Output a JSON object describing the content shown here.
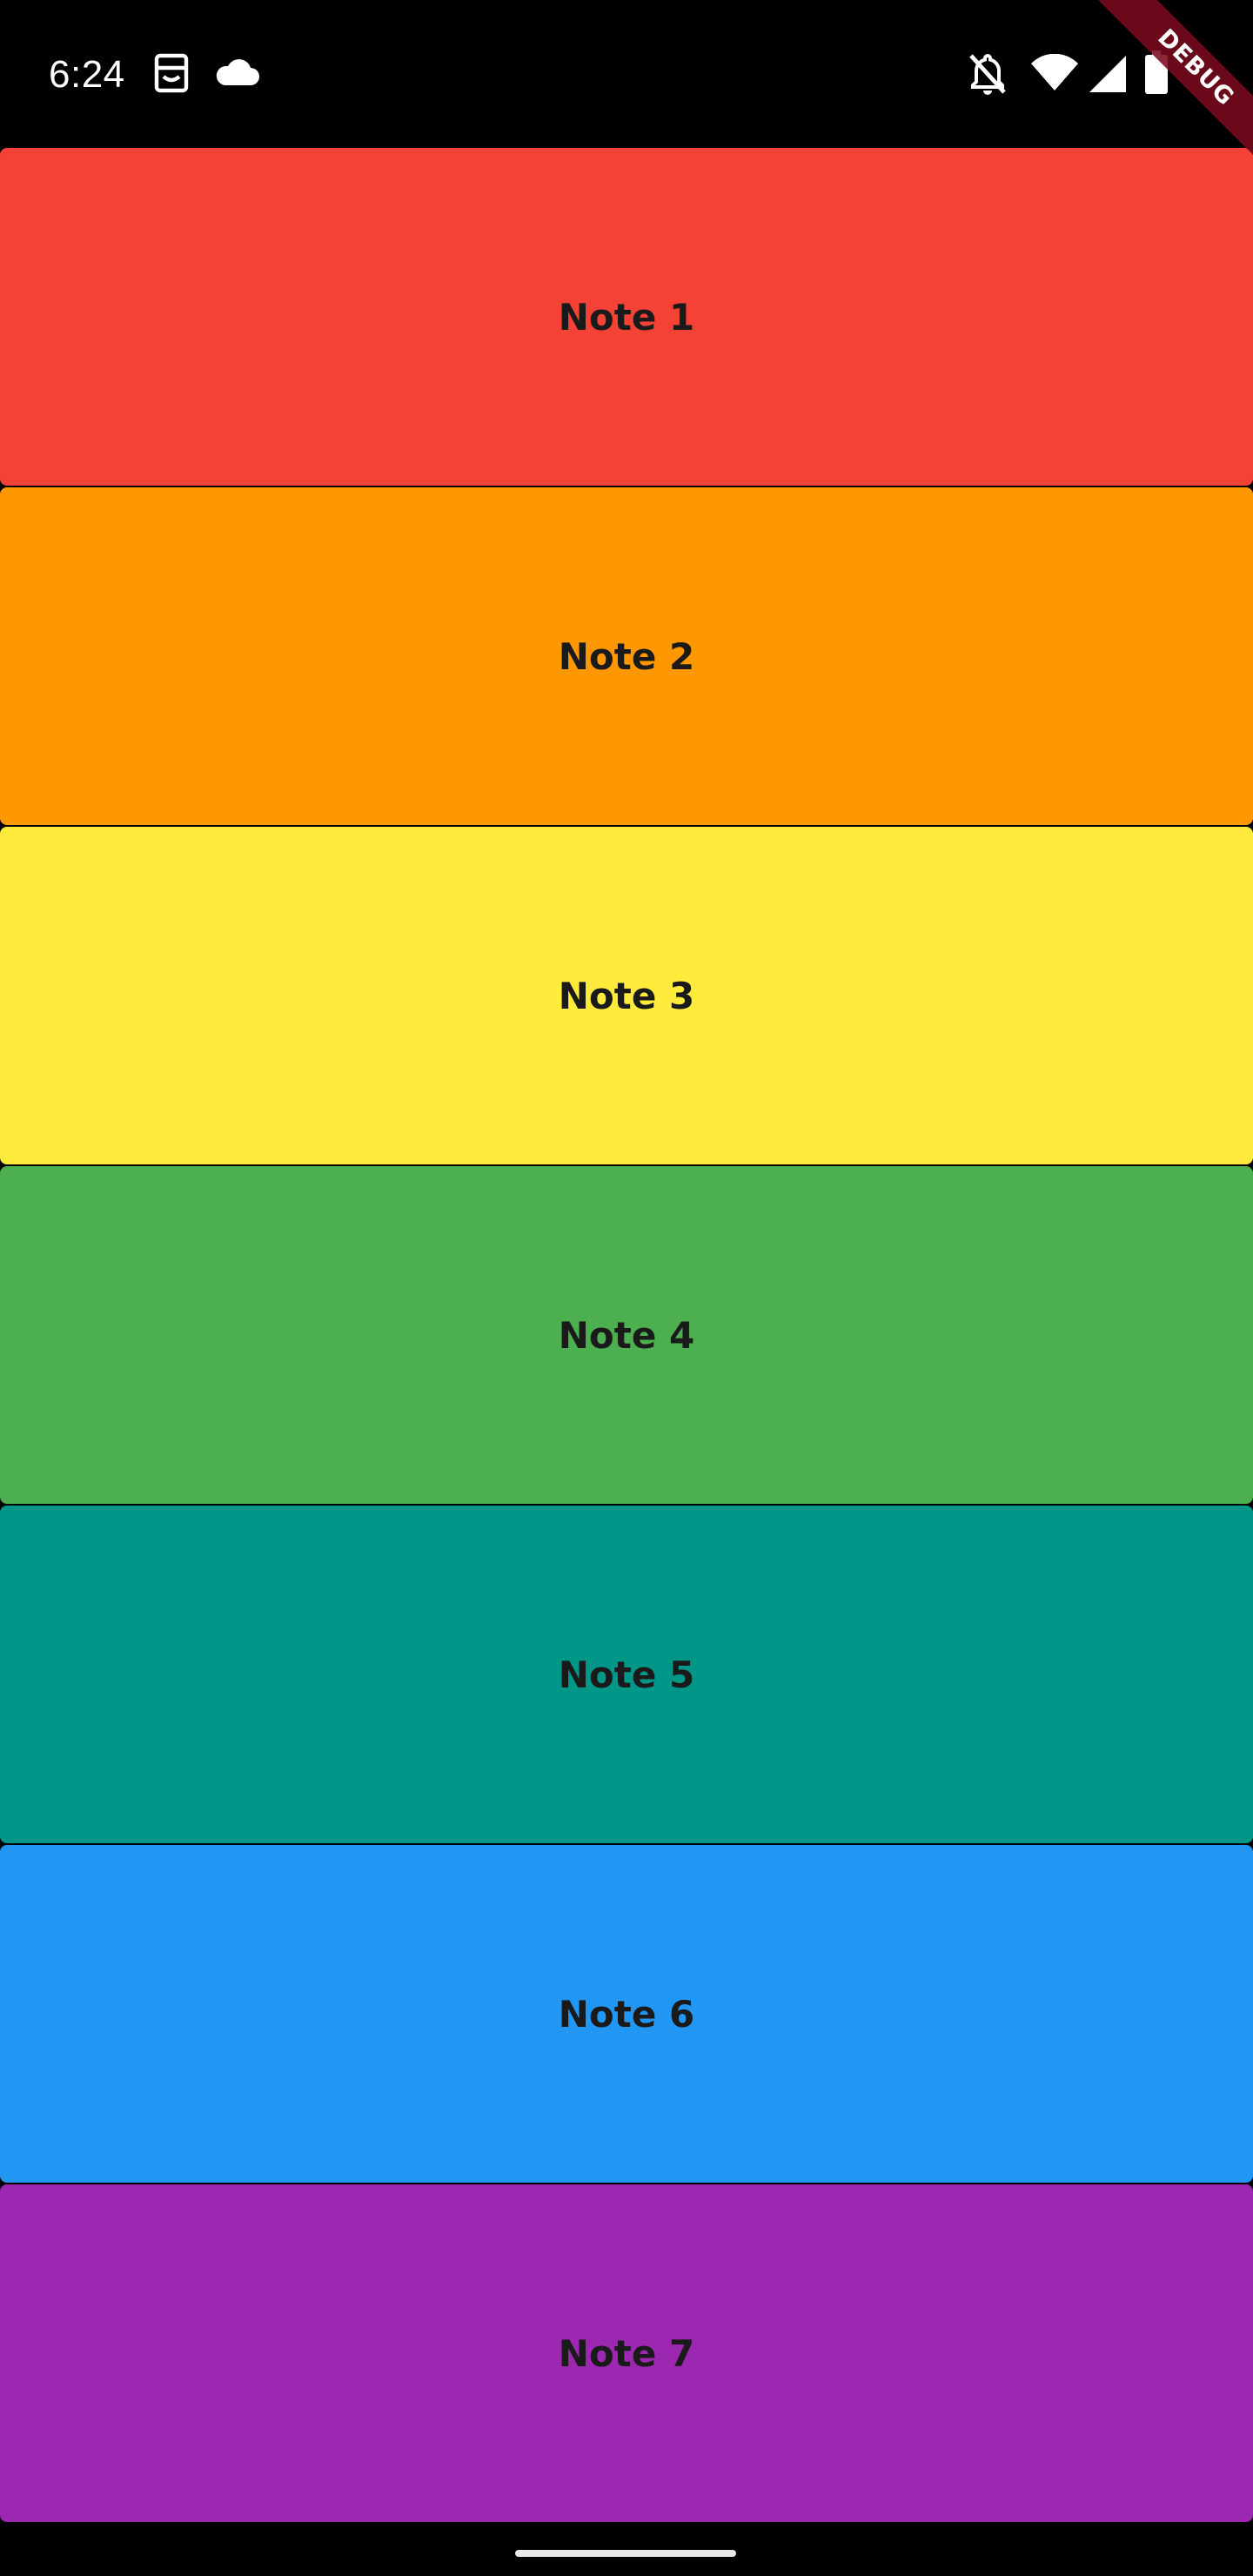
{
  "status_bar": {
    "time": "6:24",
    "icons": [
      "app-notification-icon",
      "cloud-icon",
      "bell-off-icon",
      "wifi-icon",
      "cell-signal-icon",
      "battery-icon"
    ]
  },
  "debug_banner": {
    "label": "DEBUG",
    "color": "#7a0a1e"
  },
  "notes": [
    {
      "label": "Note 1",
      "color": "#F44336"
    },
    {
      "label": "Note 2",
      "color": "#FF9800"
    },
    {
      "label": "Note 3",
      "color": "#FFEB3B"
    },
    {
      "label": "Note 4",
      "color": "#4CAF50"
    },
    {
      "label": "Note 5",
      "color": "#009688"
    },
    {
      "label": "Note 6",
      "color": "#2196F3"
    },
    {
      "label": "Note 7",
      "color": "#9C27B0"
    }
  ]
}
